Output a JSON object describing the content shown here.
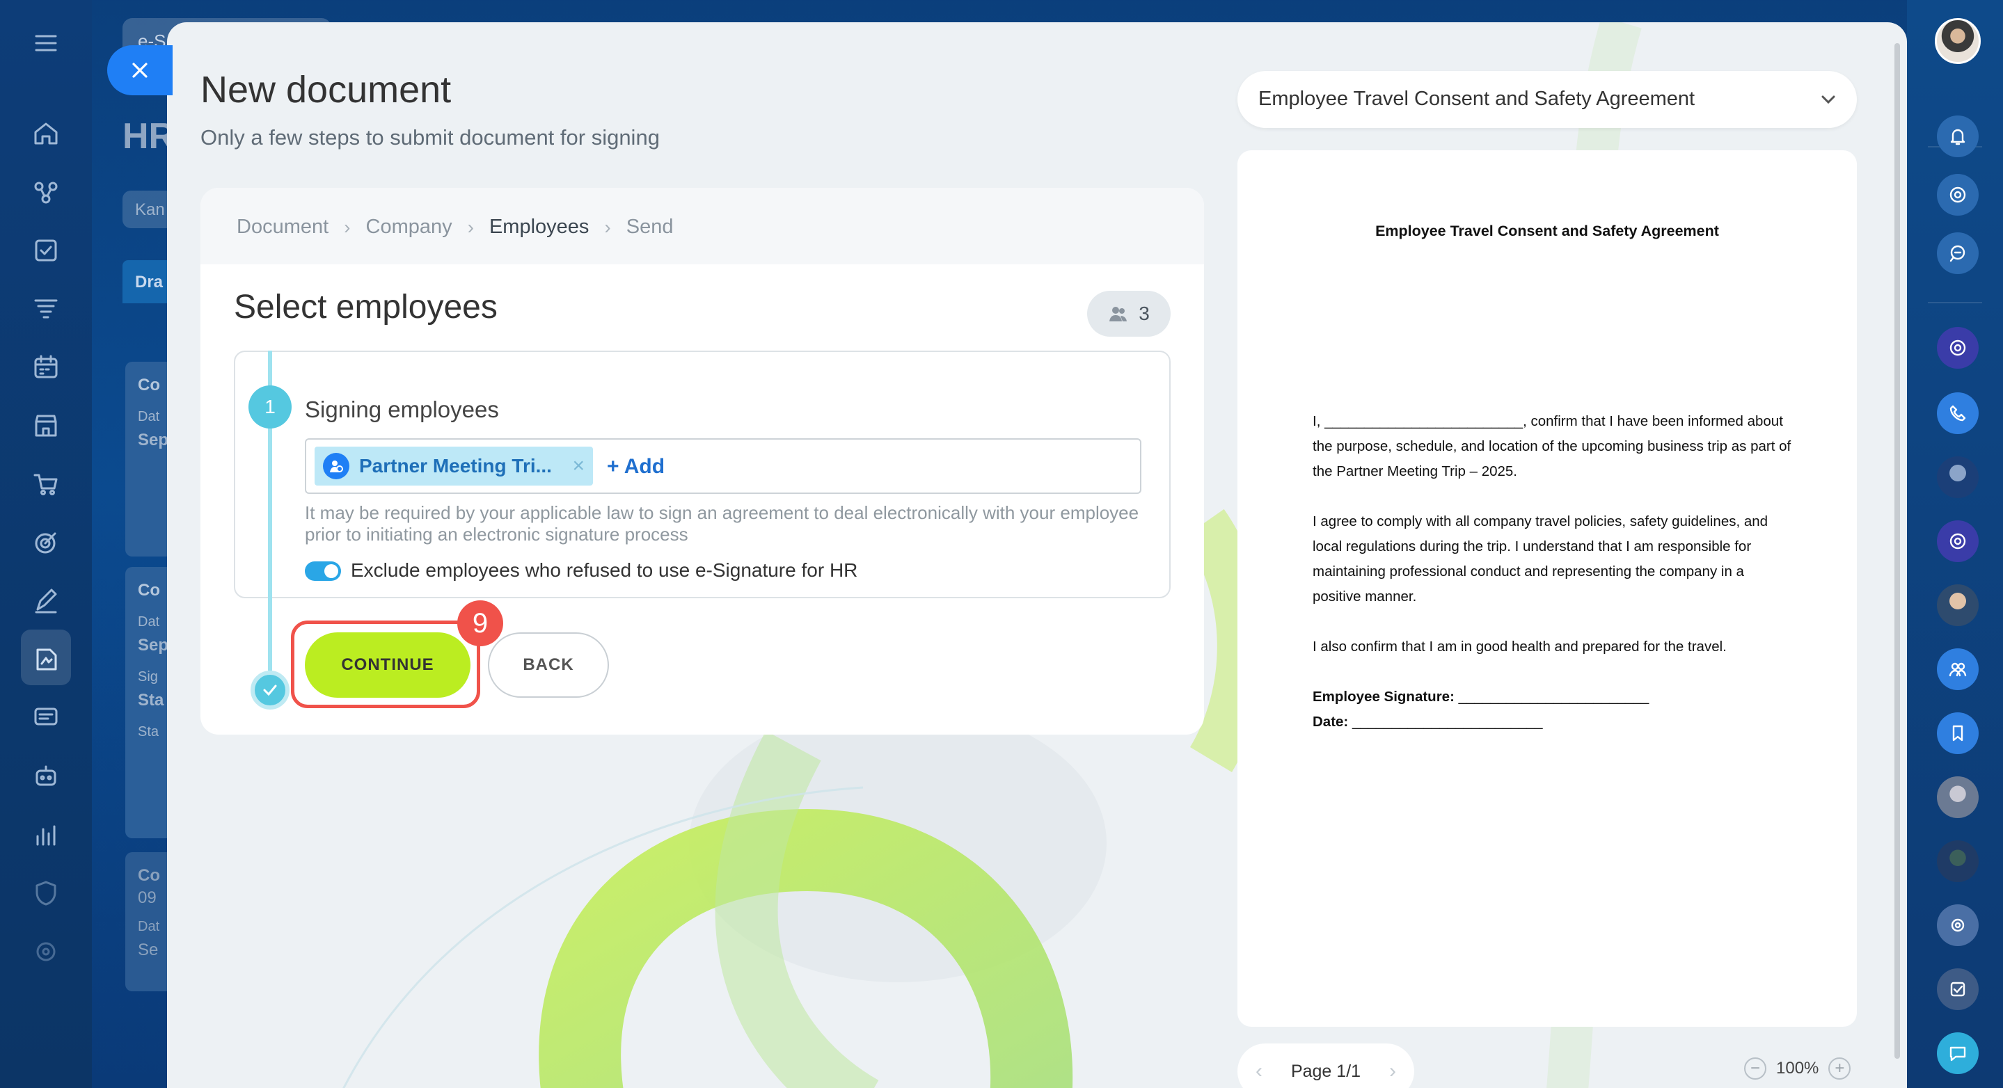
{
  "background_page": {
    "breadcrumb_fragment": "e-S",
    "title_fragment": "HR",
    "view_fragment": "Kan",
    "column_fragment": "Dra",
    "cards": [
      {
        "title": "Co",
        "line1": "Dat",
        "line2": "Sep"
      },
      {
        "title": "Co",
        "line1": "Dat",
        "line2": "Sep",
        "line3": "Sig",
        "line4": "Sta",
        "line5": "Sta"
      },
      {
        "title": "Co",
        "line1": "09",
        "line2": "Dat",
        "line3": "Se"
      }
    ]
  },
  "modal": {
    "title": "New document",
    "subtitle": "Only a few steps to submit document for signing",
    "steps": [
      "Document",
      "Company",
      "Employees",
      "Send"
    ],
    "current_step": "Employees",
    "section_title": "Select employees",
    "employee_count": "3",
    "step_number": "1",
    "step_label": "Signing employees",
    "selected_group": "Partner Meeting Tri...",
    "add_label": "+ Add",
    "legal_note": "It may be required by your applicable law to sign an agreement to deal electronically with your employee prior to initiating an electronic signature process",
    "toggle_label": "Exclude employees who refused to use e-Signature for HR",
    "toggle_on": true,
    "continue_label": "CONTINUE",
    "back_label": "BACK",
    "callout_number": "9"
  },
  "preview": {
    "template_select": "Employee Travel Consent and Safety Agreement",
    "doc_title": "Employee Travel Consent and Safety Agreement",
    "paragraph1": "I, _________________________, confirm that I have been informed about the purpose, schedule, and location of the upcoming business trip as part of the Partner Meeting Trip – 2025.",
    "paragraph2": "I agree to comply with all company travel policies, safety guidelines, and local regulations during the trip. I understand that I am responsible for maintaining professional conduct and representing the company in a positive manner.",
    "paragraph3": "I also confirm that I am in good health and prepared for the travel.",
    "signature_label": "Employee Signature:",
    "signature_line": " ________________________",
    "date_label": "Date:",
    "date_line": " ________________________",
    "page_indicator": "Page 1/1",
    "zoom": "100%"
  },
  "colors": {
    "accent_lime": "#bbed21",
    "primary_blue": "#1f7ff5",
    "callout_red": "#f0524a",
    "step_teal": "#55c8e0"
  },
  "icons": {
    "left_sidebar": [
      "menu-icon",
      "home-icon",
      "crm-icon",
      "tasks-icon",
      "funnel-icon",
      "calendar-icon",
      "store-icon",
      "cart-icon",
      "target-icon",
      "sign-icon",
      "esign-icon",
      "chat-icon",
      "robot-icon",
      "analytics-icon",
      "shield-icon",
      "settings-icon"
    ],
    "right_sidebar": [
      "bell-icon",
      "at-icon",
      "search-chat-icon",
      "support-icon",
      "phone-icon",
      "user-avatar",
      "support2-icon",
      "user-avatar",
      "group-icon",
      "bookmark-icon",
      "user-avatar",
      "user-avatar",
      "settings-avatar",
      "check-icon",
      "chat-bubble-icon"
    ]
  }
}
